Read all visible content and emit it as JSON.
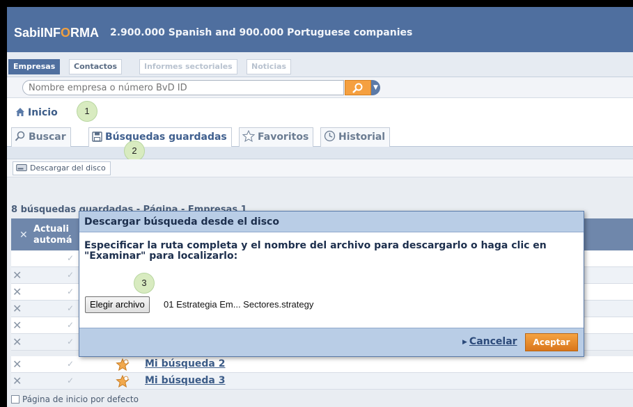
{
  "header": {
    "brand_main": "SabiINF",
    "brand_dot": "O",
    "brand_rest": "RMA",
    "tagline": "2.900.000 Spanish and 900.000 Portuguese companies",
    "bar_color": "#4f6f9f"
  },
  "module_tabs": [
    {
      "label": "Empresas",
      "state": "active"
    },
    {
      "label": "Contactos",
      "state": "normal"
    },
    {
      "label": "Informes sectoriales",
      "state": "disabled"
    },
    {
      "label": "Noticias",
      "state": "disabled"
    }
  ],
  "search": {
    "placeholder": "Nombre empresa o número BvD ID",
    "button_icon": "search-icon"
  },
  "breadcrumb": {
    "label": "Inicio",
    "icon": "home-icon"
  },
  "callouts": [
    "1",
    "2",
    "3"
  ],
  "saved_tabs": [
    {
      "label": "Buscar",
      "icon": "search-icon",
      "state": "normal"
    },
    {
      "label": "Búsquedas guardadas",
      "icon": "floppy-icon",
      "state": "active"
    },
    {
      "label": "Favoritos",
      "icon": "star-icon",
      "state": "normal"
    },
    {
      "label": "Historial",
      "icon": "clock-icon",
      "state": "normal"
    }
  ],
  "toolbar": {
    "download_label": "Descargar del disco",
    "download_icon": "disk-drive-icon"
  },
  "list": {
    "summary": "8 búsquedas guardadas - Página - Empresas 1",
    "col_header_line1": "Actuali",
    "col_header_line2": "automá",
    "rows": [
      {
        "name": ""
      },
      {
        "name": ""
      },
      {
        "name": ""
      },
      {
        "name": ""
      },
      {
        "name": ""
      },
      {
        "name": ""
      },
      {
        "name": "Mi búsqueda 2"
      },
      {
        "name": "Mi búsqueda 3"
      }
    ]
  },
  "footer": {
    "default_page_label": "Página de inicio por defecto"
  },
  "dialog": {
    "title": "Descargar búsqueda desde el disco",
    "message": "Especificar la ruta completa y el nombre del archivo para descargarlo o haga clic en \"Examinar\" para localizarlo:",
    "file_button": "Elegir archivo",
    "file_name": "01 Estrategia Em... Sectores.strategy",
    "cancel_label": "Cancelar",
    "accept_label": "Aceptar",
    "accept_color": "#e8892e"
  }
}
